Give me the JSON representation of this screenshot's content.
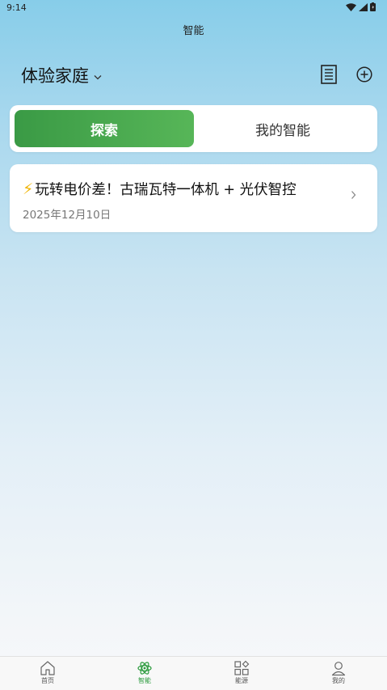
{
  "status": {
    "time": "9:14"
  },
  "header": {
    "title": "智能"
  },
  "home": {
    "name": "体验家庭"
  },
  "tabs": [
    {
      "label": "探索",
      "active": true
    },
    {
      "label": "我的智能",
      "active": false
    }
  ],
  "card": {
    "icon": "lightning-icon",
    "title": "玩转电价差！古瑞瓦特一体机 + 光伏智控",
    "date": "2025年12月10日"
  },
  "nav": [
    {
      "label": "首页",
      "icon": "home-icon"
    },
    {
      "label": "智能",
      "icon": "atom-icon",
      "active": true
    },
    {
      "label": "能源",
      "icon": "grid-icon"
    },
    {
      "label": "我的",
      "icon": "user-icon"
    }
  ],
  "colors": {
    "accent": "#3a9a45",
    "nav_active": "#2a9a3c"
  }
}
